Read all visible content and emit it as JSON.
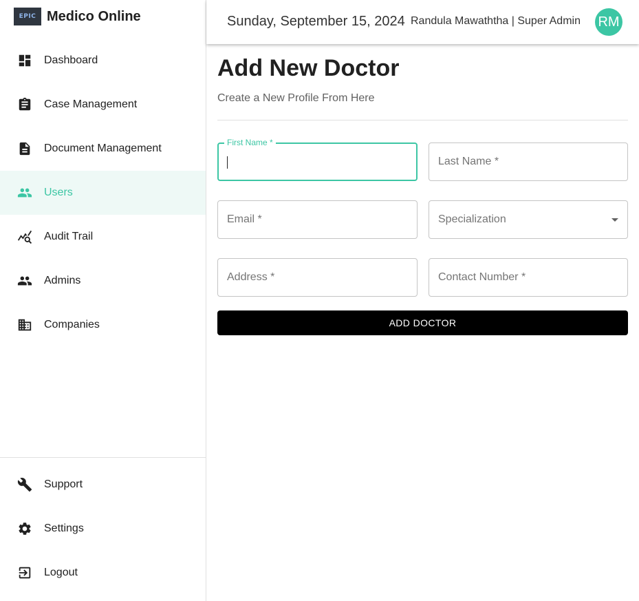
{
  "brand": {
    "logo_text": "EPIC",
    "name": "Medico Online"
  },
  "sidebar": {
    "items": [
      {
        "label": "Dashboard",
        "icon": "dashboard-icon",
        "active": false
      },
      {
        "label": "Case Management",
        "icon": "clipboard-icon",
        "active": false
      },
      {
        "label": "Document Management",
        "icon": "document-icon",
        "active": false
      },
      {
        "label": "Users",
        "icon": "users-icon",
        "active": true
      },
      {
        "label": "Audit Trail",
        "icon": "audit-search-icon",
        "active": false
      },
      {
        "label": "Admins",
        "icon": "admins-icon",
        "active": false
      },
      {
        "label": "Companies",
        "icon": "companies-icon",
        "active": false
      }
    ],
    "bottom_items": [
      {
        "label": "Support",
        "icon": "wrench-icon"
      },
      {
        "label": "Settings",
        "icon": "gear-icon"
      },
      {
        "label": "Logout",
        "icon": "logout-icon"
      }
    ]
  },
  "header": {
    "date": "Sunday, September 15, 2024",
    "user": "Randula Mawaththa | Super Admin",
    "avatar_initials": "RM"
  },
  "main": {
    "title": "Add New Doctor",
    "subtitle": "Create a New Profile From Here",
    "fields": {
      "first_name": {
        "label": "First Name *",
        "value": ""
      },
      "last_name": {
        "placeholder": "Last Name *",
        "value": ""
      },
      "email": {
        "placeholder": "Email *",
        "value": ""
      },
      "specialization": {
        "placeholder": "Specialization",
        "value": ""
      },
      "address": {
        "placeholder": "Address *",
        "value": ""
      },
      "contact_number": {
        "placeholder": "Contact Number *",
        "value": ""
      }
    },
    "submit_label": "ADD DOCTOR"
  },
  "colors": {
    "accent": "#3cc6a4",
    "active_bg": "#eef9f6",
    "button_bg": "#000000"
  }
}
